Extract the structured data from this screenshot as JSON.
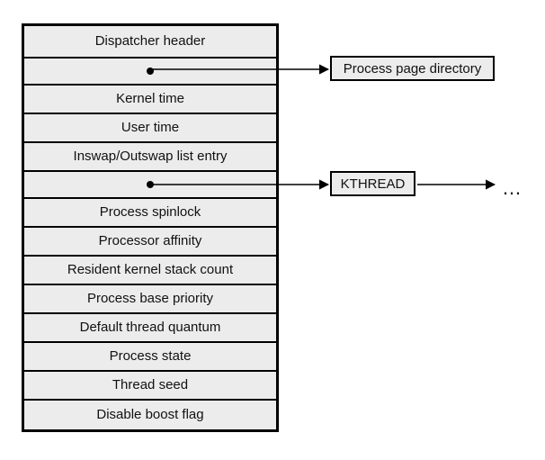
{
  "block": {
    "rows": [
      "Dispatcher header",
      "",
      "Kernel time",
      "User time",
      "Inswap/Outswap list entry",
      "",
      "Process spinlock",
      "Processor affinity",
      "Resident kernel stack count",
      "Process base priority",
      "Default thread quantum",
      "Process state",
      "Thread seed",
      "Disable boost flag"
    ]
  },
  "external": {
    "page_directory": "Process page directory",
    "kthread": "KTHREAD"
  },
  "ellipsis": "…",
  "chart_data": {
    "type": "table",
    "description": "KPROCESS structure fields with two pointer fields",
    "fields": [
      "Dispatcher header",
      "(pointer) → Process page directory",
      "Kernel time",
      "User time",
      "Inswap/Outswap list entry",
      "(pointer) → KTHREAD → ...",
      "Process spinlock",
      "Processor affinity",
      "Resident kernel stack count",
      "Process base priority",
      "Default thread quantum",
      "Process state",
      "Thread seed",
      "Disable boost flag"
    ],
    "pointers": [
      {
        "from_field_index": 1,
        "to": "Process page directory"
      },
      {
        "from_field_index": 5,
        "to": "KTHREAD",
        "continues": true
      }
    ]
  }
}
